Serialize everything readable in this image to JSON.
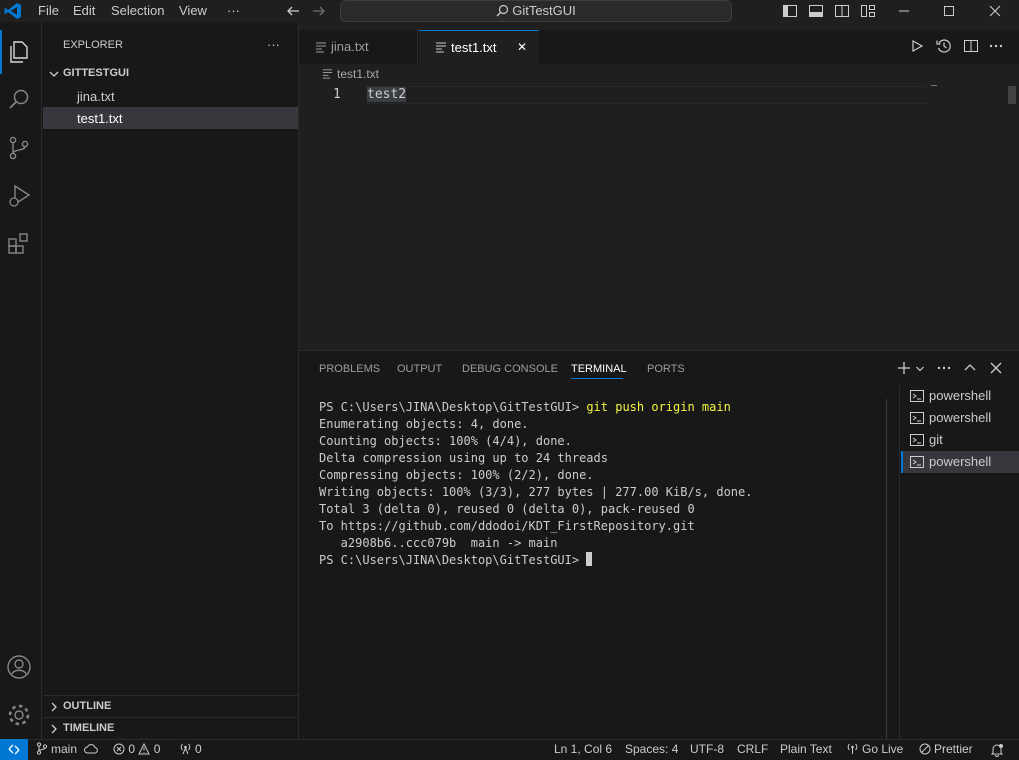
{
  "titlebar": {
    "menus": [
      "File",
      "Edit",
      "Selection",
      "View",
      "···"
    ],
    "search_label": "GitTestGUI"
  },
  "sidebar": {
    "title": "EXPLORER",
    "more": "···",
    "folder": "GITTESTGUI",
    "files": [
      "jina.txt",
      "test1.txt"
    ],
    "outline": "OUTLINE",
    "timeline": "TIMELINE"
  },
  "editor": {
    "tabs": [
      "jina.txt",
      "test1.txt"
    ],
    "close_glyph": "✕",
    "breadcrumb": "test1.txt",
    "line_number": "1",
    "line_text": "test2"
  },
  "panel": {
    "tabs": [
      "PROBLEMS",
      "OUTPUT",
      "DEBUG CONSOLE",
      "TERMINAL",
      "PORTS"
    ],
    "active_tab": "TERMINAL",
    "terminal": {
      "prompt": "PS C:\\Users\\JINA\\Desktop\\GitTestGUI>",
      "command": "git push origin main",
      "output": [
        "Enumerating objects: 4, done.",
        "Counting objects: 100% (4/4), done.",
        "Delta compression using up to 24 threads",
        "Compressing objects: 100% (2/2), done.",
        "Writing objects: 100% (3/3), 277 bytes | 277.00 KiB/s, done.",
        "Total 3 (delta 0), reused 0 (delta 0), pack-reused 0",
        "To https://github.com/ddodoi/KDT_FirstRepository.git",
        "   a2908b6..ccc079b  main -> main"
      ],
      "final_prompt": "PS C:\\Users\\JINA\\Desktop\\GitTestGUI>"
    },
    "terminal_list": [
      "powershell",
      "powershell",
      "git",
      "powershell"
    ]
  },
  "statusbar": {
    "branch": "main",
    "errors": "0",
    "warnings": "0",
    "ports": "0",
    "position": "Ln 1, Col 6",
    "spaces": "Spaces: 4",
    "encoding": "UTF-8",
    "eol": "CRLF",
    "language": "Plain Text",
    "golive": "Go Live",
    "prettier": "Prettier"
  },
  "colors": {
    "accent": "#0078d4",
    "remote": "#0078d4",
    "background": "#1f1f1f",
    "command": "#f5f543"
  }
}
